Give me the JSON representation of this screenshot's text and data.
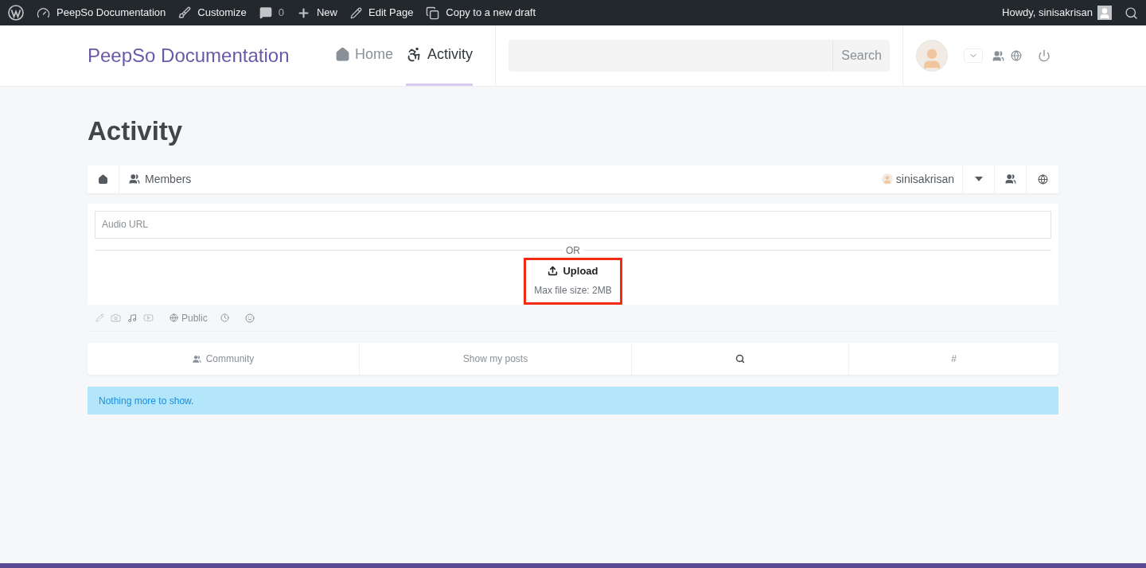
{
  "admin_bar": {
    "items": [
      {
        "kind": "wordpress"
      },
      {
        "kind": "site",
        "label": "PeepSo Documentation"
      },
      {
        "kind": "customize",
        "label": "Customize"
      },
      {
        "kind": "comments",
        "label": "0"
      },
      {
        "kind": "new",
        "label": "New"
      },
      {
        "kind": "edit",
        "label": "Edit Page"
      },
      {
        "kind": "copy",
        "label": "Copy to a new draft"
      }
    ],
    "greeting": "Howdy, sinisakrisan"
  },
  "header": {
    "site_title": "PeepSo Documentation",
    "nav": [
      {
        "kind": "home",
        "label": "Home",
        "selected": false
      },
      {
        "kind": "activity",
        "label": "Activity",
        "selected": true
      }
    ],
    "search": {
      "button": "Search"
    }
  },
  "page_title": "Activity",
  "toolbar": {
    "members": "Members",
    "user": "sinisakrisan"
  },
  "postbox": {
    "audio_url": {
      "placeholder": "Audio URL"
    },
    "or": "OR",
    "upload": "Upload",
    "max_size": "Max file size: 2MB",
    "privacy": "Public"
  },
  "filters": [
    {
      "kind": "community",
      "label": "Community"
    },
    {
      "kind": "text",
      "label": "Show my posts"
    },
    {
      "kind": "search"
    },
    {
      "kind": "text",
      "label": "#"
    }
  ],
  "notice": "Nothing more to show."
}
